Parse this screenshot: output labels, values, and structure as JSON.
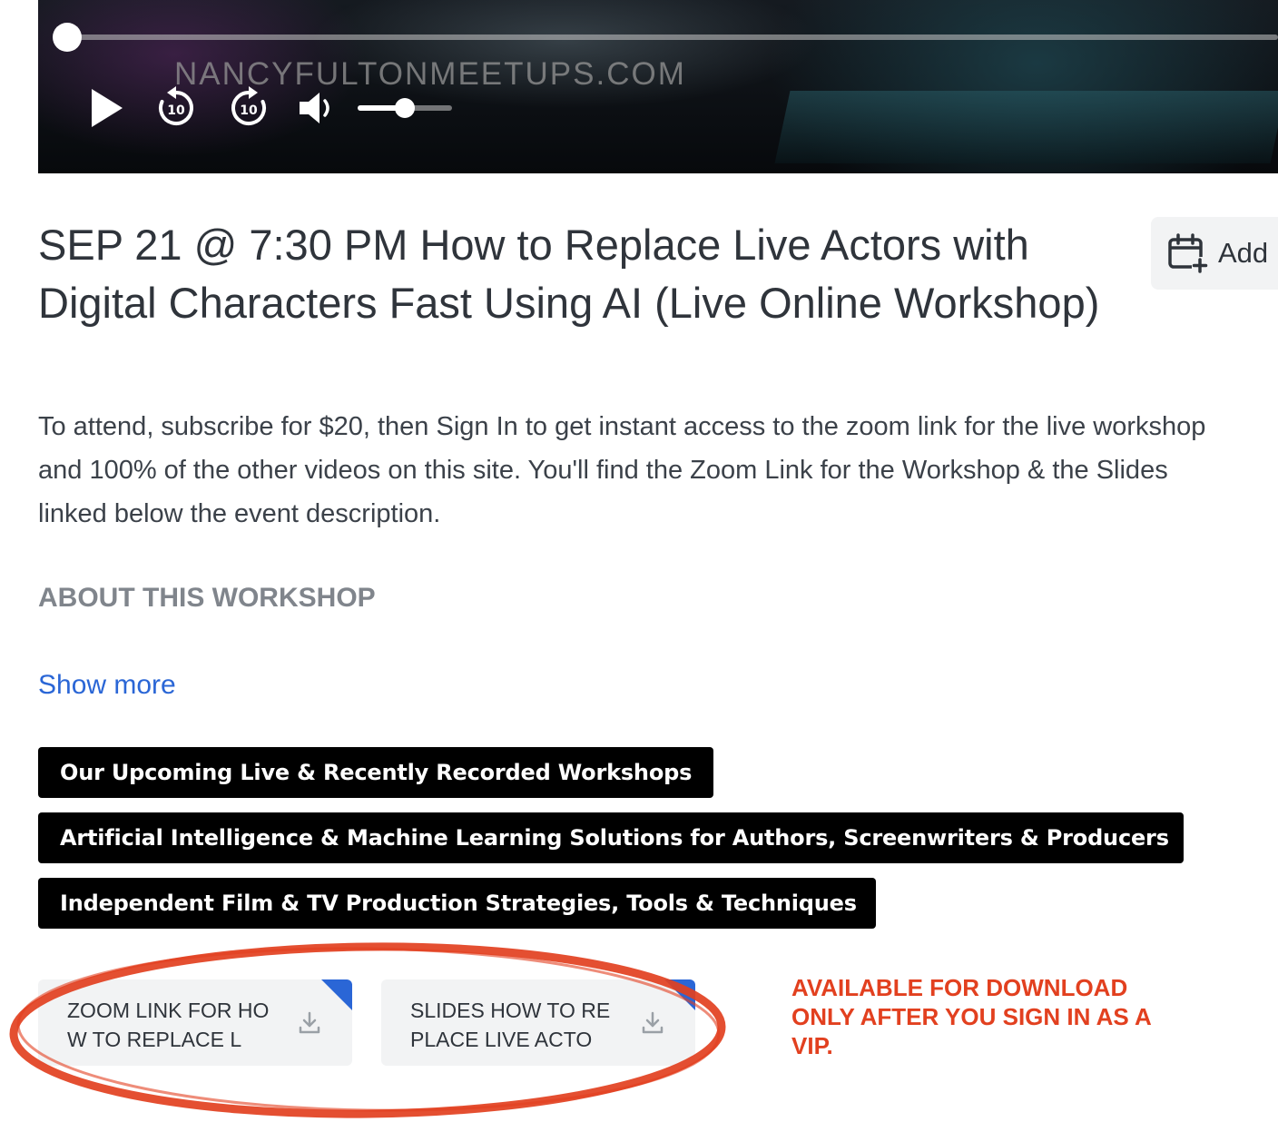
{
  "video": {
    "watermark": "NANCYFULTONMEETUPS.COM",
    "progress_fraction": 0.0,
    "volume_fraction": 0.5,
    "controls": {
      "play": "play-icon",
      "rewind": "rewind-10-icon",
      "forward": "forward-10-icon",
      "volume": "volume-icon",
      "skip_label": "10"
    }
  },
  "event": {
    "title": "SEP 21 @ 7:30 PM How to Replace Live Actors with Digital Characters Fast Using AI (Live Online Workshop)",
    "add_to_calendar_label": "Add",
    "description": "To attend, subscribe for $20, then Sign In to get instant access to the zoom link for the live workshop\nand 100% of the other videos on this site.  You'll find the Zoom Link for the Workshop & the Slides\nlinked below the event description.",
    "section_heading": "ABOUT THIS WORKSHOP",
    "show_more": "Show more"
  },
  "tags": [
    "Our Upcoming Live & Recently Recorded Workshops",
    "Artificial Intelligence & Machine Learning Solutions for Authors, Screenwriters & Producers",
    "Independent Film & TV Production Strategies, Tools & Techniques"
  ],
  "attachments": [
    {
      "name": "ZOOM LINK FOR HOW TO REPLACE L"
    },
    {
      "name": "SLIDES HOW TO REPLACE LIVE ACTO"
    }
  ],
  "annotation": {
    "notice": "AVAILABLE FOR DOWNLOAD ONLY AFTER YOU SIGN IN AS A VIP."
  },
  "colors": {
    "link": "#2a66d6",
    "annotation_red": "#e2401f",
    "tag_bg": "#000000",
    "text": "#2f343b"
  }
}
